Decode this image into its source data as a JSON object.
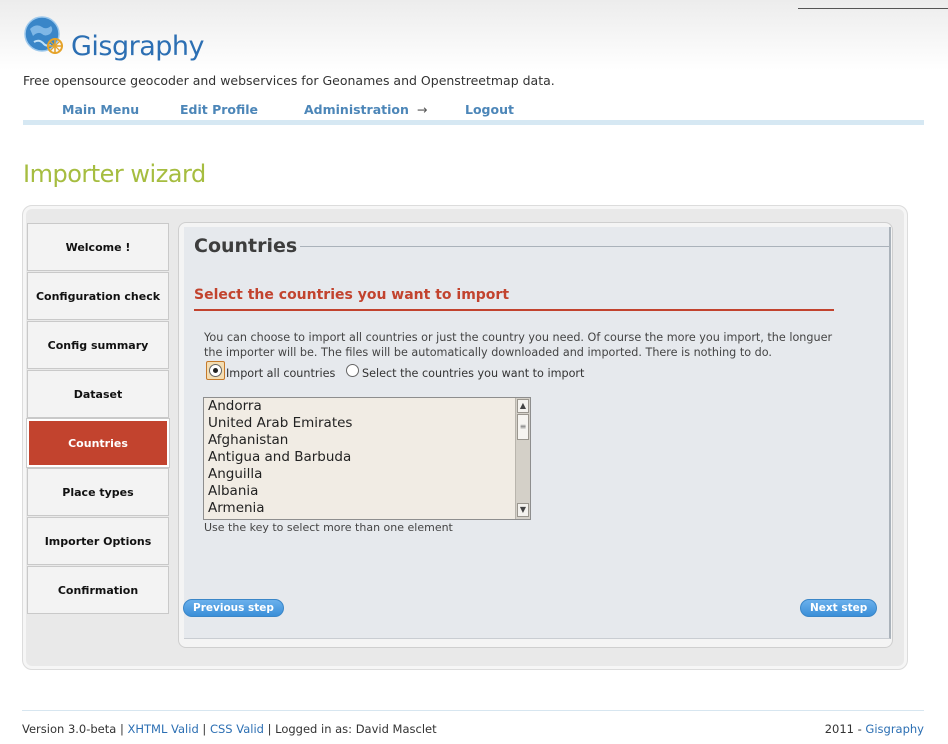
{
  "header": {
    "brand": "Gisgraphy",
    "tagline": "Free opensource geocoder and webservices for Geonames and Openstreetmap data."
  },
  "nav": {
    "items": [
      {
        "label": "Main Menu"
      },
      {
        "label": "Edit Profile"
      },
      {
        "label": "Administration",
        "arrow": "→"
      },
      {
        "label": "Logout"
      }
    ]
  },
  "page_title": "Importer wizard",
  "steps": [
    {
      "label": "Welcome !"
    },
    {
      "label": "Configuration check"
    },
    {
      "label": "Config summary"
    },
    {
      "label": "Dataset"
    },
    {
      "label": "Countries",
      "active": true
    },
    {
      "label": "Place types"
    },
    {
      "label": "Importer Options"
    },
    {
      "label": "Confirmation"
    }
  ],
  "panel": {
    "title": "Countries",
    "subtitle": "Select the countries you want to import",
    "intro": "You can choose to import all countries or just the country you need. Of course the more you import, the longuer the importer will be. The files will be automatically downloaded and imported. There is nothing to do.",
    "radio_all_label": "Import all countries",
    "radio_select_label": "Select the countries you want to import",
    "selected_option": "all",
    "countries": [
      "Andorra",
      "United Arab Emirates",
      "Afghanistan",
      "Antigua and Barbuda",
      "Anguilla",
      "Albania",
      "Armenia"
    ],
    "hint": "Use the key to select more than one element",
    "prev_button": "Previous step",
    "next_button": "Next step"
  },
  "footer": {
    "version": "Version 3.0-beta |",
    "xhtml": "XHTML Valid",
    "sep": "|",
    "css": "CSS Valid",
    "logged_in": "| Logged in as: David Masclet",
    "year": "2011 -",
    "brand_link": "Gisgraphy"
  },
  "colors": {
    "brand_blue": "#2c6fb3",
    "accent_red": "#c2432e",
    "title_green": "#a6bd40"
  }
}
